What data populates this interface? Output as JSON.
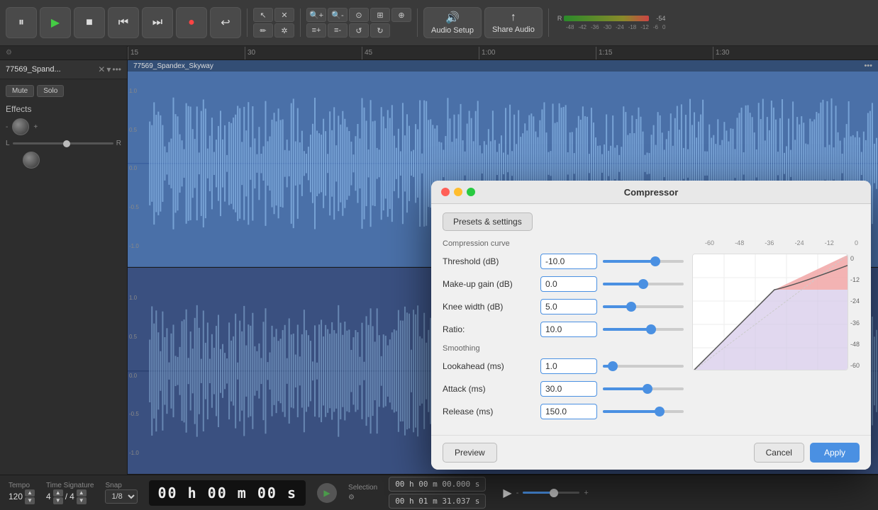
{
  "app": {
    "title": "Compressor"
  },
  "toolbar": {
    "pause_label": "⏸",
    "play_label": "▶",
    "stop_label": "■",
    "back_label": "⏮",
    "forward_label": "⏭",
    "record_label": "●",
    "loop_label": "↩",
    "audio_setup_label": "Audio Setup",
    "share_audio_label": "Share Audio",
    "volume_icon": "🔊"
  },
  "ruler": {
    "marks": [
      "15",
      "30",
      "45",
      "1:00",
      "1:15",
      "1:30"
    ]
  },
  "track": {
    "name": "77569_Spand...",
    "clip_name": "77569_Spandex_Skyway",
    "mute_label": "Mute",
    "solo_label": "Solo",
    "effects_label": "Effects"
  },
  "bottom_bar": {
    "tempo_label": "Tempo",
    "tempo_value": "120",
    "time_sig_label": "Time Signature",
    "time_sig_num": "4",
    "time_sig_den": "4",
    "snap_label": "Snap",
    "snap_value": "1/8",
    "time_display": "00 h 00 m 00 s",
    "selection_label": "Selection",
    "selection_start": "00 h 00 m 00.000 s",
    "selection_end": "00 h 01 m 31.037 s"
  },
  "compressor": {
    "title": "Compressor",
    "presets_tab": "Presets & settings",
    "curve_section_label": "Compression curve",
    "threshold_label": "Threshold (dB)",
    "threshold_value": "-10.0",
    "threshold_pct": 65,
    "makeup_label": "Make-up gain (dB)",
    "makeup_value": "0.0",
    "makeup_pct": 50,
    "knee_label": "Knee width (dB)",
    "knee_value": "5.0",
    "knee_pct": 35,
    "ratio_label": "Ratio:",
    "ratio_value": "10.0",
    "ratio_pct": 60,
    "smoothing_label": "Smoothing",
    "lookahead_label": "Lookahead (ms)",
    "lookahead_value": "1.0",
    "lookahead_pct": 12,
    "attack_label": "Attack (ms)",
    "attack_value": "30.0",
    "attack_pct": 55,
    "release_label": "Release (ms)",
    "release_value": "150.0",
    "release_pct": 70,
    "preview_label": "Preview",
    "cancel_label": "Cancel",
    "apply_label": "Apply",
    "db_labels": [
      "-60",
      "-48",
      "-36",
      "-24",
      "-12",
      "0"
    ],
    "db_labels_right": [
      "0",
      "-12",
      "-24",
      "-36",
      "-48",
      "-60"
    ]
  }
}
